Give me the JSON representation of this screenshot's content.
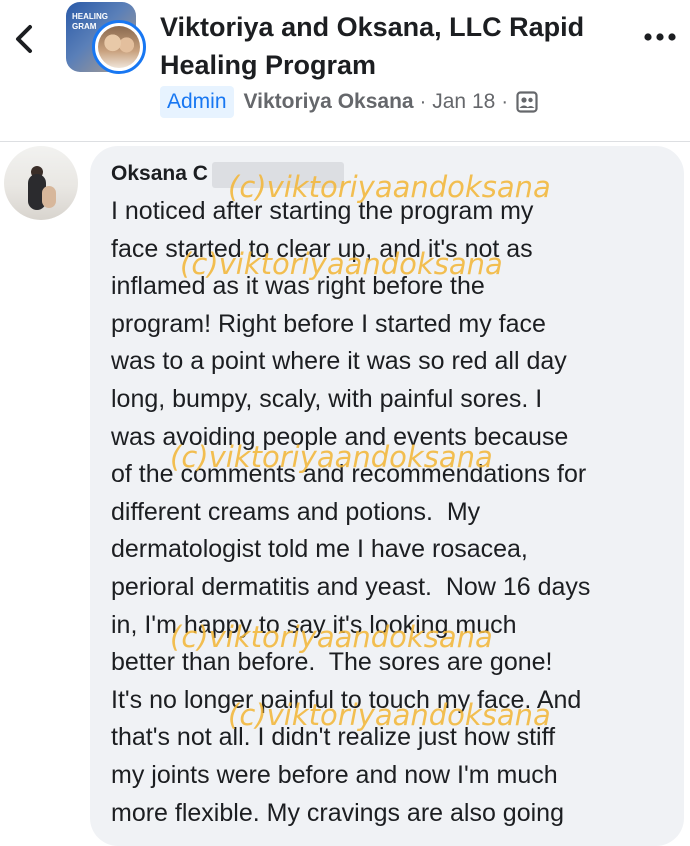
{
  "header": {
    "title": "Viktoriya and Oksana, LLC Rapid Healing Program",
    "group_avatar_text": "HEALING\nGRAM",
    "badge": "Admin",
    "author": "Viktoriya Oksana",
    "separator_1": "·",
    "date": "Jan 18",
    "separator_2": "·",
    "icons": {
      "back": "chevron-left-icon",
      "more": "more-dots-icon",
      "audience": "group-members-icon"
    }
  },
  "comment": {
    "author": "Oksana C",
    "text": "I noticed after starting the program my\nface started to clear up, and it's not as\ninflamed as it was right before the\nprogram! Right before I started my face\nwas to a point where it was so red all day\nlong, bumpy, scaly, with painful sores. I\nwas avoiding people and events because\nof the comments and recommendations for\ndifferent creams and potions.  My\ndermatologist told me I have rosacea,\nperioral dermatitis and yeast.  Now 16 days\nin, I'm happy to say it's looking much\nbetter than before.  The sores are gone!\nIt's no longer painful to touch my face. And\nthat's not all. I didn't realize just how stiff\nmy joints were before and now I'm much\nmore flexible. My cravings are also going"
  },
  "watermark": "(c)viktoriyaandoksana",
  "colors": {
    "accent": "#1877f2",
    "watermark": "#f3b73a",
    "bubble": "#f0f2f5"
  }
}
